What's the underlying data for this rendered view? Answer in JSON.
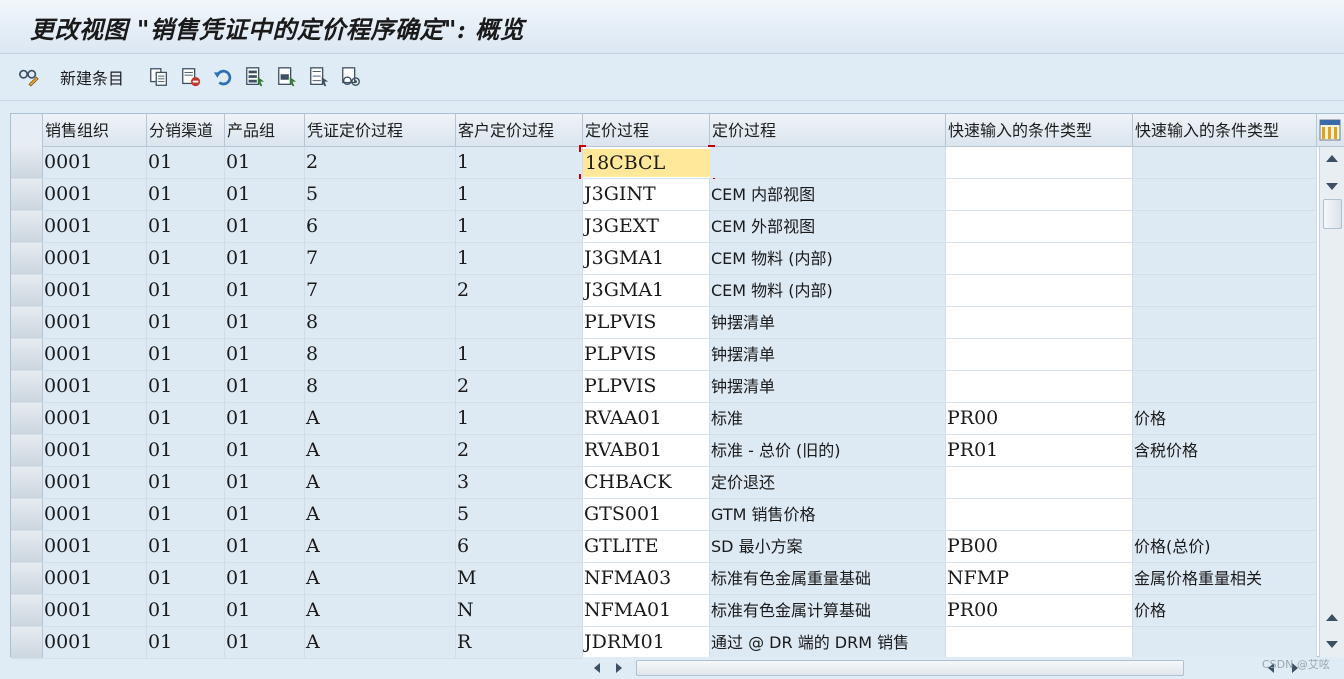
{
  "title": "更改视图 \"销售凭证中的定价程序确定\": 概览",
  "toolbar": {
    "items": [
      {
        "icon": "glasses-pencil-icon"
      },
      {
        "label": "新建条目",
        "icon": "new-entries"
      },
      {
        "icon": "copy-icon"
      },
      {
        "icon": "delete-icon"
      },
      {
        "icon": "undo-icon"
      },
      {
        "icon": "select-all-icon"
      },
      {
        "icon": "select-block-icon"
      },
      {
        "icon": "deselect-all-icon"
      },
      {
        "icon": "configuration-icon"
      }
    ]
  },
  "table": {
    "columns": [
      "销售组织",
      "分销渠道",
      "产品组",
      "凭证定价过程",
      "客户定价过程",
      "定价过程",
      "定价过程",
      "快速输入的条件类型",
      "快速输入的条件类型"
    ],
    "rows": [
      [
        "0001",
        "01",
        "01",
        "2",
        "1",
        "18CBCL",
        "",
        "",
        ""
      ],
      [
        "0001",
        "01",
        "01",
        "5",
        "1",
        "J3GINT",
        "CEM 内部视图",
        "",
        ""
      ],
      [
        "0001",
        "01",
        "01",
        "6",
        "1",
        "J3GEXT",
        "CEM 外部视图",
        "",
        ""
      ],
      [
        "0001",
        "01",
        "01",
        "7",
        "1",
        "J3GMA1",
        "CEM 物料 (内部)",
        "",
        ""
      ],
      [
        "0001",
        "01",
        "01",
        "7",
        "2",
        "J3GMA1",
        "CEM 物料 (内部)",
        "",
        ""
      ],
      [
        "0001",
        "01",
        "01",
        "8",
        "",
        "PLPVIS",
        "钟摆清单",
        "",
        ""
      ],
      [
        "0001",
        "01",
        "01",
        "8",
        "1",
        "PLPVIS",
        "钟摆清单",
        "",
        ""
      ],
      [
        "0001",
        "01",
        "01",
        "8",
        "2",
        "PLPVIS",
        "钟摆清单",
        "",
        ""
      ],
      [
        "0001",
        "01",
        "01",
        "A",
        "1",
        "RVAA01",
        "标准",
        "PR00",
        "价格"
      ],
      [
        "0001",
        "01",
        "01",
        "A",
        "2",
        "RVAB01",
        "标准 - 总价 (旧的)",
        "PR01",
        "含税价格"
      ],
      [
        "0001",
        "01",
        "01",
        "A",
        "3",
        "CHBACK",
        "定价退还",
        "",
        ""
      ],
      [
        "0001",
        "01",
        "01",
        "A",
        "5",
        "GTS001",
        "GTM 销售价格",
        "",
        ""
      ],
      [
        "0001",
        "01",
        "01",
        "A",
        "6",
        "GTLITE",
        "SD 最小方案",
        "PB00",
        "价格(总价)"
      ],
      [
        "0001",
        "01",
        "01",
        "A",
        "M",
        "NFMA03",
        "标准有色金属重量基础",
        "NFMP",
        "金属价格重量相关"
      ],
      [
        "0001",
        "01",
        "01",
        "A",
        "N",
        "NFMA01",
        "标准有色金属计算基础",
        "PR00",
        "价格"
      ],
      [
        "0001",
        "01",
        "01",
        "A",
        "R",
        "JDRM01",
        "通过 @ DR 端的 DRM 销售",
        "",
        ""
      ]
    ],
    "focused_cell": {
      "row": 0,
      "column": 5
    }
  },
  "watermark": "CSDN @艾呟",
  "colors": {
    "readonly_cell": "#dde9f3",
    "editable_cell": "#ffffff",
    "focus_cell": "#ffe89a",
    "focus_corner": "#c00000"
  }
}
